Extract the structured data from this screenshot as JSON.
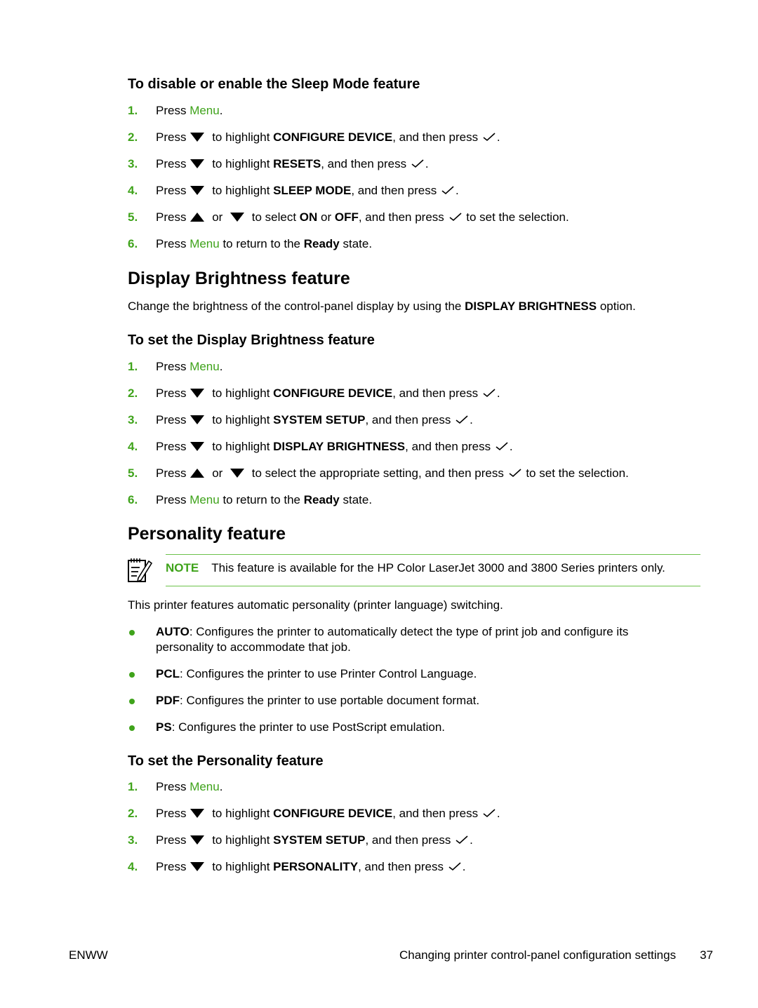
{
  "sections": {
    "sleep": {
      "heading": "To disable or enable the Sleep Mode feature",
      "steps": [
        {
          "num": "1.",
          "pre": "Press ",
          "menu": "Menu",
          "post": "."
        },
        {
          "num": "2.",
          "pre": "Press",
          "mid": " to highlight ",
          "bold": "CONFIGURE DEVICE",
          "post": ", and then press",
          "end": "."
        },
        {
          "num": "3.",
          "pre": "Press",
          "mid": " to highlight ",
          "bold": "RESETS",
          "post": ", and then press",
          "end": "."
        },
        {
          "num": "4.",
          "pre": "Press",
          "mid": " to highlight ",
          "bold": "SLEEP MODE",
          "post": ", and then press",
          "end": "."
        },
        {
          "num": "5.",
          "pre": "Press",
          "or": " or ",
          "mid": " to select ",
          "bold1": "ON",
          "or2": " or ",
          "bold2": "OFF",
          "post": ", and then press",
          "end": " to set the selection."
        },
        {
          "num": "6.",
          "pre": "Press ",
          "menu": "Menu",
          "post": " to return to the ",
          "bold": "Ready",
          "end": " state."
        }
      ]
    },
    "brightness": {
      "title": "Display Brightness feature",
      "intro_pre": "Change the brightness of the control-panel display by using the ",
      "intro_bold": "DISPLAY BRIGHTNESS",
      "intro_post": " option.",
      "heading": "To set the Display Brightness feature",
      "steps": [
        {
          "num": "1.",
          "pre": "Press ",
          "menu": "Menu",
          "post": "."
        },
        {
          "num": "2.",
          "pre": "Press",
          "mid": " to highlight ",
          "bold": "CONFIGURE DEVICE",
          "post": ", and then press",
          "end": "."
        },
        {
          "num": "3.",
          "pre": "Press",
          "mid": " to highlight ",
          "bold": "SYSTEM SETUP",
          "post": ", and then press",
          "end": "."
        },
        {
          "num": "4.",
          "pre": "Press",
          "mid": " to highlight ",
          "bold": "DISPLAY BRIGHTNESS",
          "post": ", and then press",
          "end": "."
        },
        {
          "num": "5.",
          "pre": "Press",
          "or": " or ",
          "mid": " to select the appropriate setting, and then press",
          "end": " to set the selection."
        },
        {
          "num": "6.",
          "pre": "Press ",
          "menu": "Menu",
          "post": " to return to the ",
          "bold": "Ready",
          "end": " state."
        }
      ]
    },
    "personality": {
      "title": "Personality feature",
      "note_label": "NOTE",
      "note_text": "This feature is available for the HP Color LaserJet 3000 and 3800 Series printers only.",
      "intro": "This printer features automatic personality (printer language) switching.",
      "bullets": [
        {
          "term": "AUTO",
          "desc": ": Configures the printer to automatically detect the type of print job and configure its personality to accommodate that job."
        },
        {
          "term": "PCL",
          "desc": ": Configures the printer to use Printer Control Language."
        },
        {
          "term": "PDF",
          "desc": ": Configures the printer to use portable document format."
        },
        {
          "term": "PS",
          "desc": ": Configures the printer to use PostScript emulation."
        }
      ],
      "heading": "To set the Personality feature",
      "steps": [
        {
          "num": "1.",
          "pre": "Press ",
          "menu": "Menu",
          "post": "."
        },
        {
          "num": "2.",
          "pre": "Press",
          "mid": " to highlight ",
          "bold": "CONFIGURE DEVICE",
          "post": ", and then press",
          "end": "."
        },
        {
          "num": "3.",
          "pre": "Press",
          "mid": " to highlight ",
          "bold": "SYSTEM SETUP",
          "post": ", and then press",
          "end": "."
        },
        {
          "num": "4.",
          "pre": "Press",
          "mid": " to highlight ",
          "bold": "PERSONALITY",
          "post": ", and then press",
          "end": "."
        }
      ]
    }
  },
  "footer": {
    "left": "ENWW",
    "title": "Changing printer control-panel configuration settings",
    "page": "37"
  },
  "colors": {
    "accent": "#3fa31b",
    "rule": "#6cc24a"
  }
}
